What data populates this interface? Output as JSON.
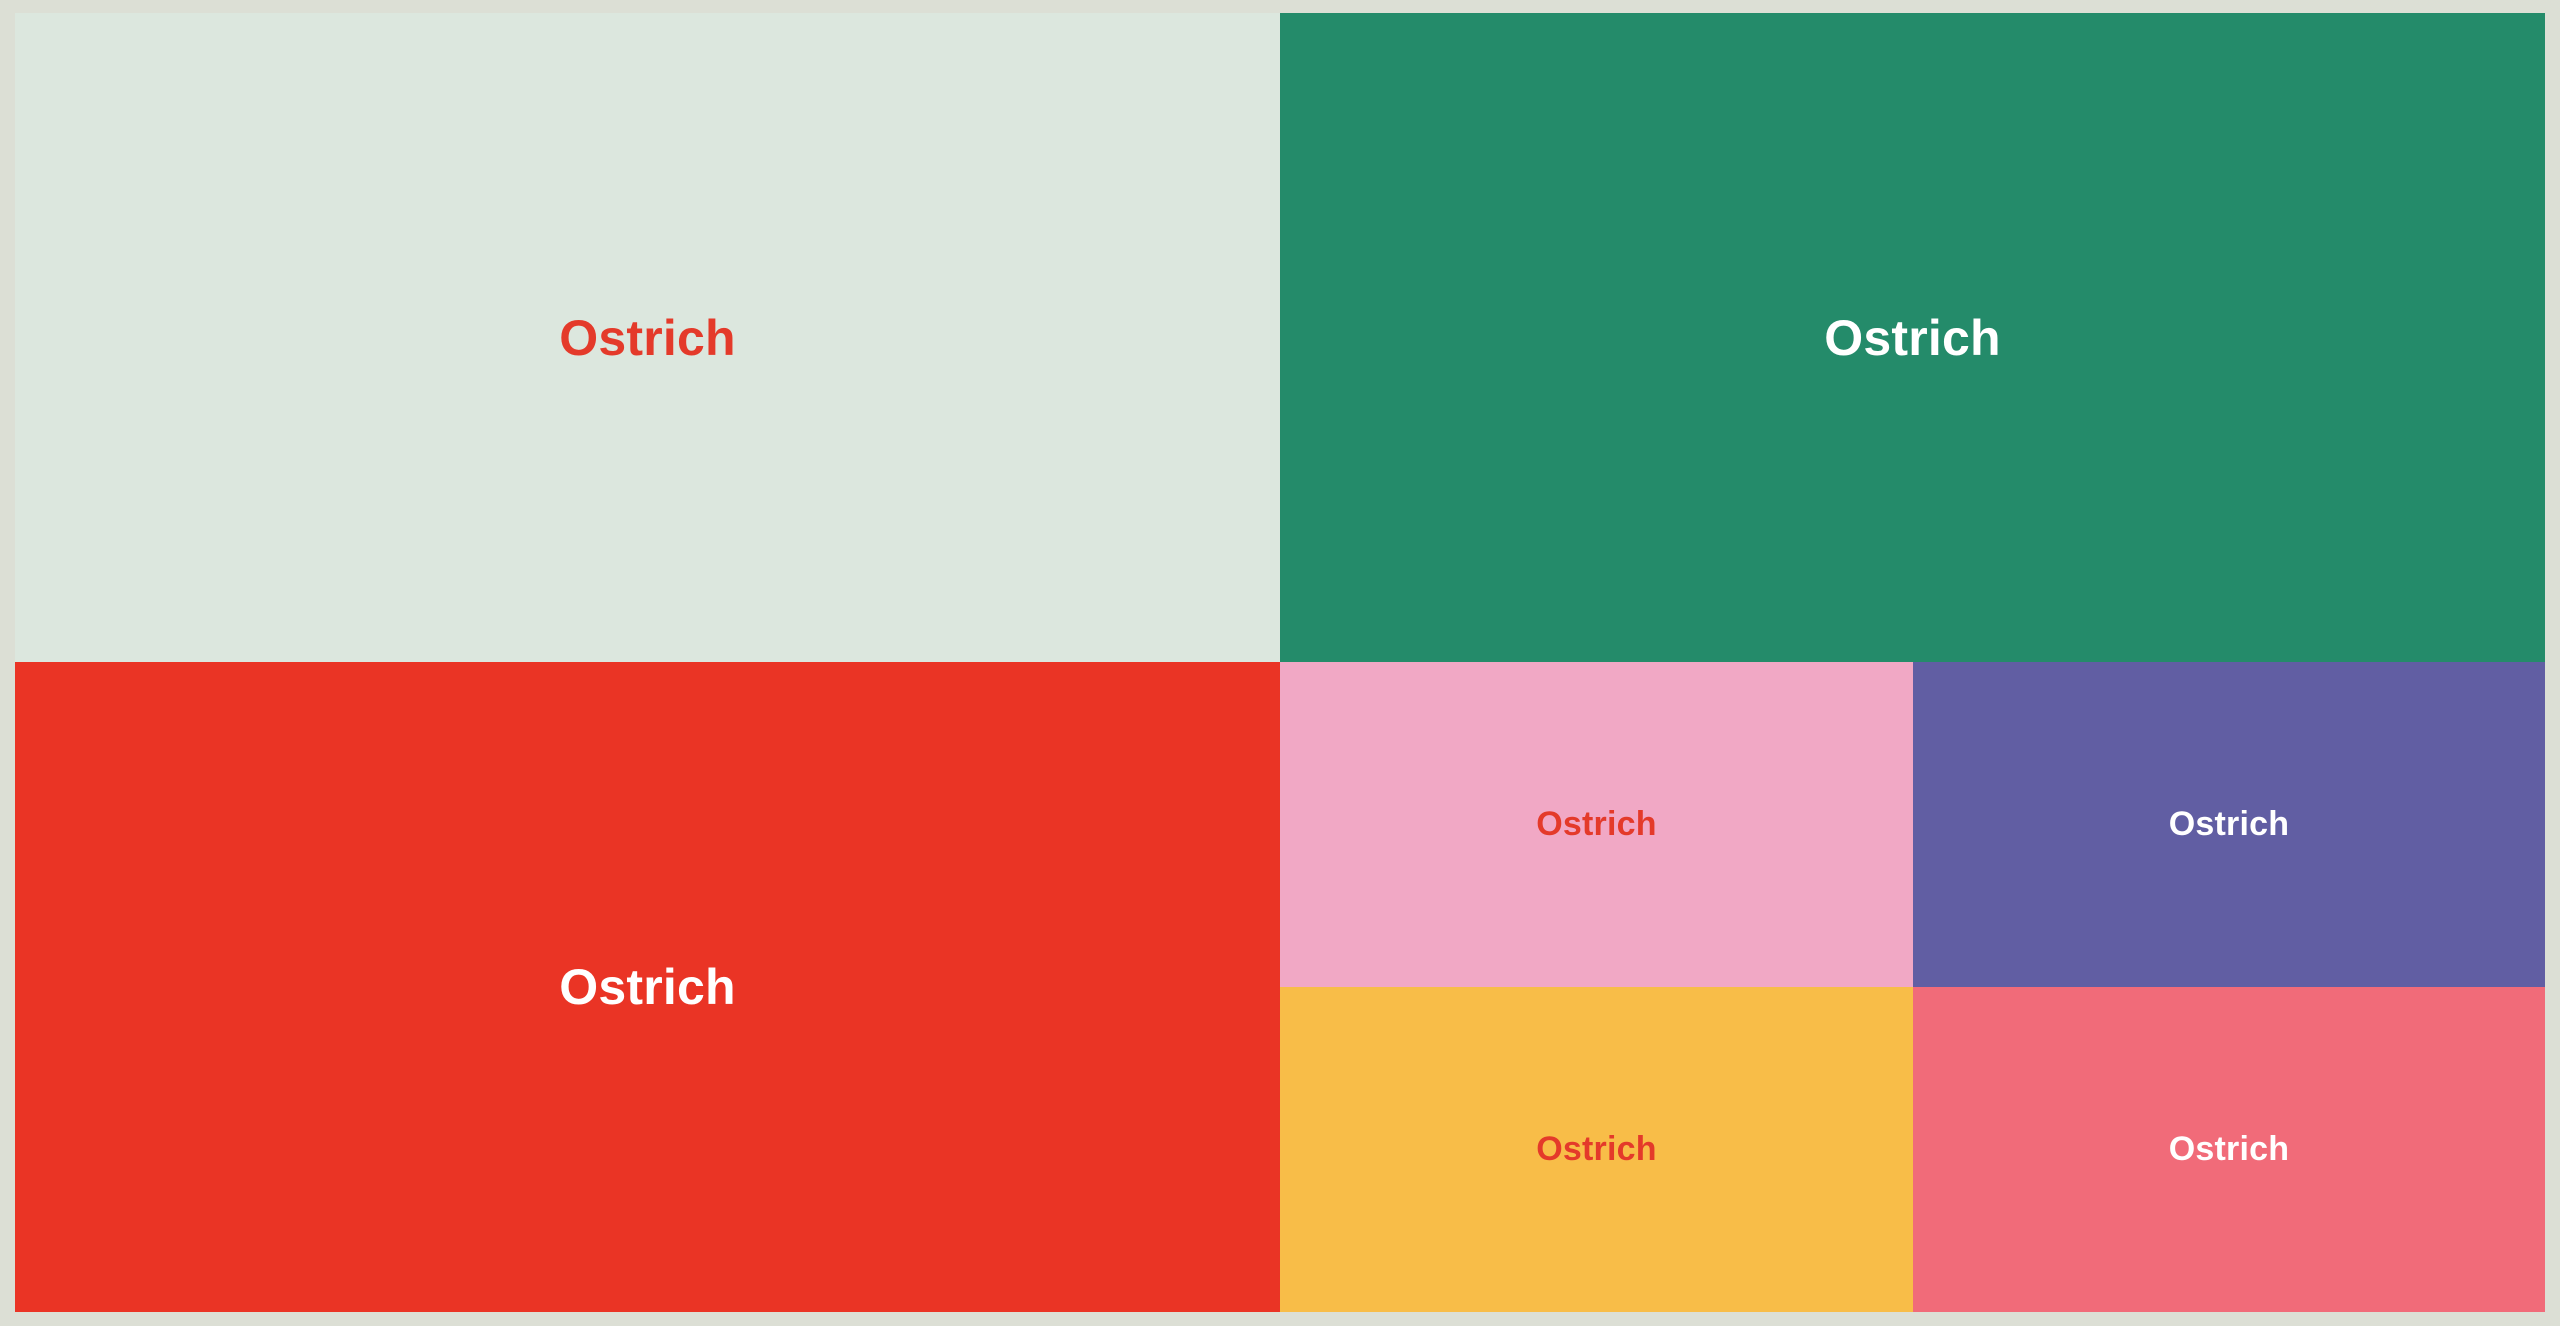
{
  "treemap": {
    "tiles": [
      {
        "label": "Ostrich",
        "fill": "#dce7de",
        "text_color": "#e43a2a"
      },
      {
        "label": "Ostrich",
        "fill": "#248b6a",
        "text_color": "#ffffff"
      },
      {
        "label": "Ostrich",
        "fill": "#ea3425",
        "text_color": "#ffffff"
      },
      {
        "label": "Ostrich",
        "fill": "#f1a8c5",
        "text_color": "#e43a2a"
      },
      {
        "label": "Ostrich",
        "fill": "#615ea3",
        "text_color": "#ffffff"
      },
      {
        "label": "Ostrich",
        "fill": "#f8bd48",
        "text_color": "#e43a2a"
      },
      {
        "label": "Ostrich",
        "fill": "#f16b79",
        "text_color": "#ffffff"
      }
    ]
  }
}
